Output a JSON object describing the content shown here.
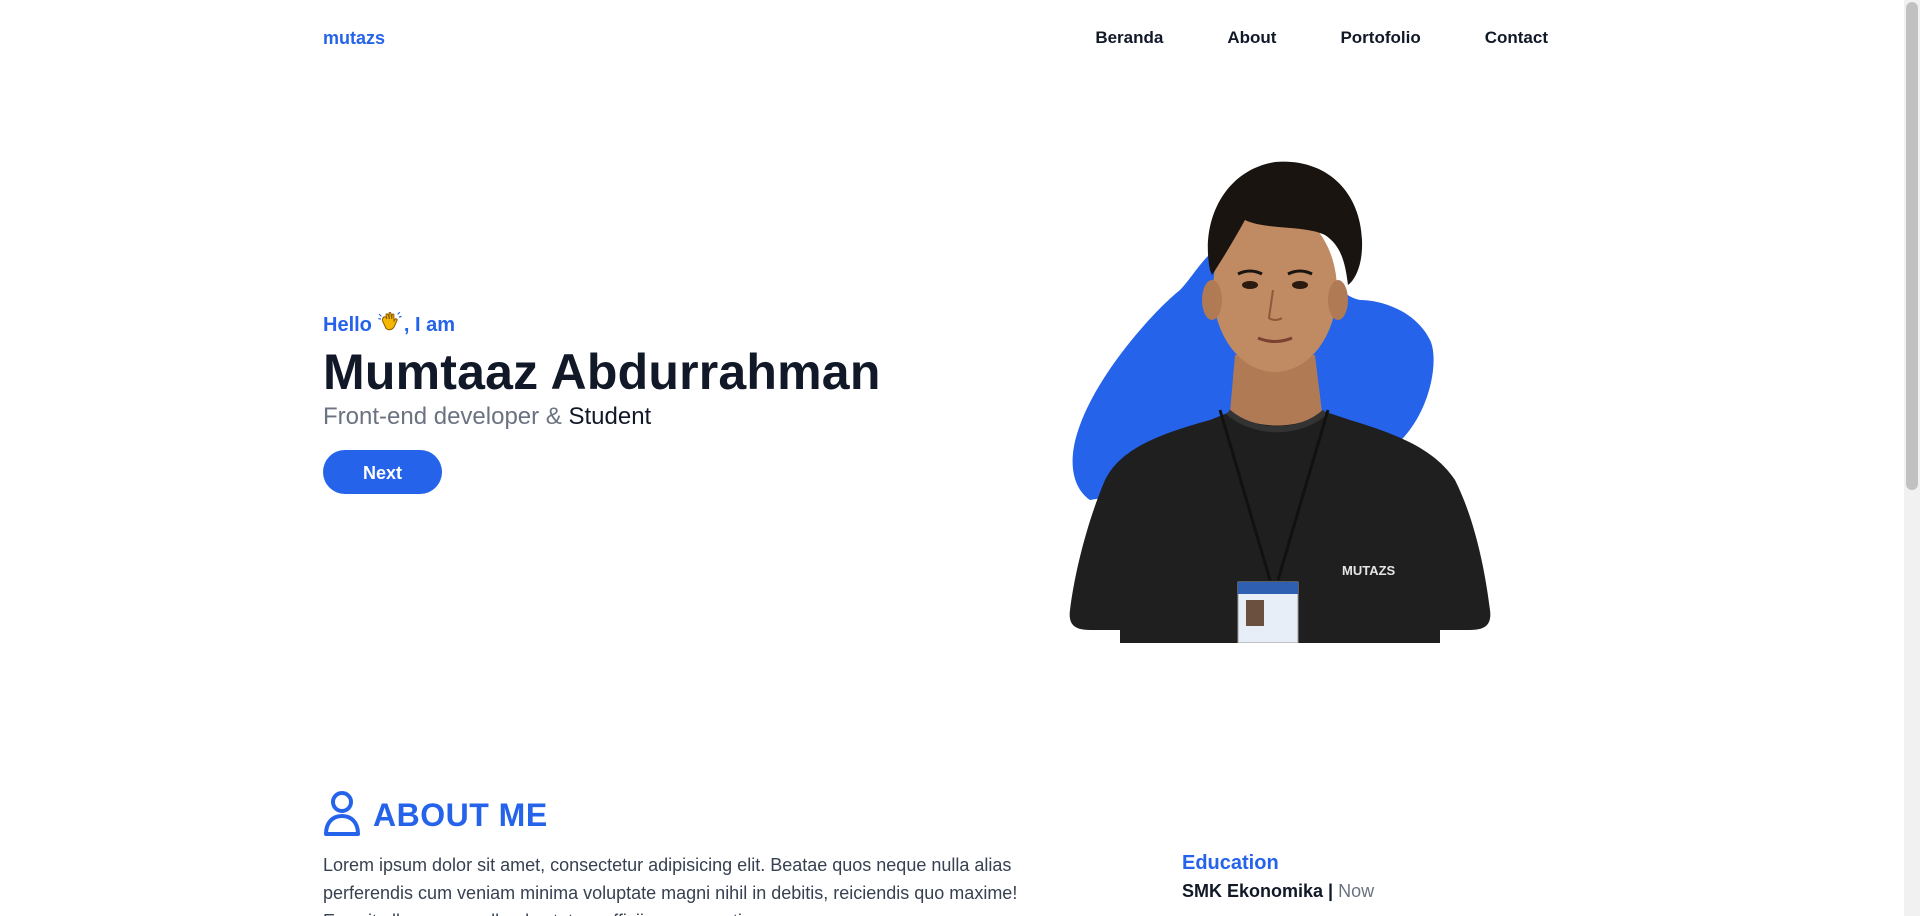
{
  "nav": {
    "brand": "mutazs",
    "items": [
      {
        "label": "Beranda"
      },
      {
        "label": "About"
      },
      {
        "label": "Portofolio"
      },
      {
        "label": "Contact"
      }
    ]
  },
  "hero": {
    "hello": "Hello",
    "hello_suffix": ", I am",
    "wave_icon": "waving-hand-icon",
    "name": "Mumtaaz Abdurrahman",
    "role_prefix": "Front-end developer &",
    "role_suffix": "Student",
    "button_label": "Next",
    "image_shirt_text": "MUTAZS"
  },
  "about": {
    "title": "ABOUT ME",
    "icon": "user-icon",
    "description": "Lorem ipsum dolor sit amet, consectetur adipisicing elit. Beatae quos neque nulla alias perferendis cum veniam minima voluptate magni nihil in debitis, reiciendis quo maxime! Eos sit ullam ea repellendus totam officiis ex corrupti.",
    "education": {
      "heading": "Education",
      "school": "SMK Ekonomika",
      "separator": "|",
      "period": "Now"
    }
  },
  "colors": {
    "accent": "#2563eb",
    "text_dark": "#111827",
    "text_muted": "#6b7280"
  }
}
